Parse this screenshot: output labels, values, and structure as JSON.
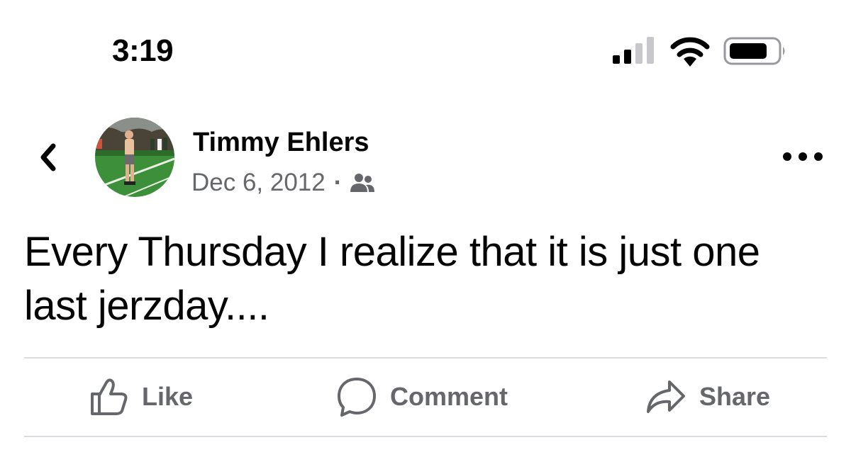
{
  "status_bar": {
    "time": "3:19",
    "signal_icon": "cellular-signal-icon",
    "wifi_icon": "wifi-icon",
    "battery_icon": "battery-icon"
  },
  "header": {
    "back_icon": "chevron-left-icon",
    "author_name": "Timmy Ehlers",
    "date": "Dec 6, 2012",
    "separator": "·",
    "audience_icon": "friends-icon",
    "more_icon": "more-horizontal-icon"
  },
  "post": {
    "text": "Every Thursday I realize that it is just one last jerzday...."
  },
  "actions": {
    "like_label": "Like",
    "comment_label": "Comment",
    "share_label": "Share"
  },
  "colors": {
    "primary_text": "#050505",
    "secondary_text": "#65676b",
    "divider": "#dadde1",
    "background": "#ffffff"
  }
}
